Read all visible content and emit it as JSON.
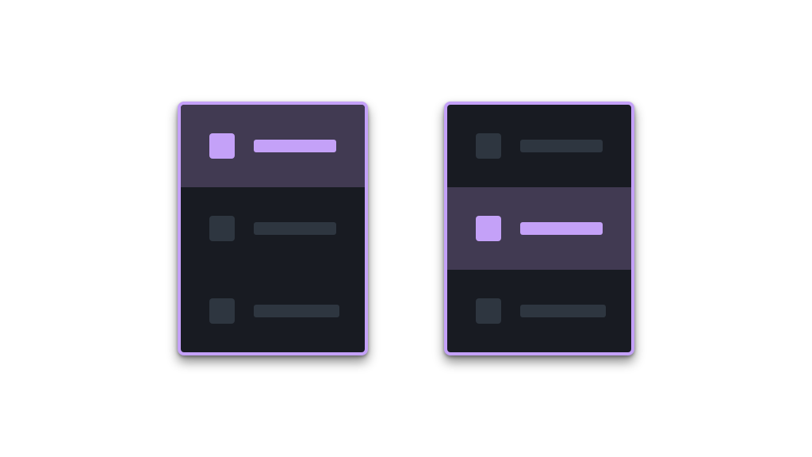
{
  "colors": {
    "accent": "#c4a1f8",
    "panel_background": "#181b22",
    "selected_row_background": "#413a52",
    "placeholder": "#2e3640",
    "page_background": "#ffffff"
  },
  "panels": [
    {
      "id": "left",
      "selected_index": 0,
      "items": [
        {
          "icon": "square-icon",
          "state": "selected"
        },
        {
          "icon": "square-icon",
          "state": "default"
        },
        {
          "icon": "square-icon",
          "state": "default"
        }
      ]
    },
    {
      "id": "right",
      "selected_index": 1,
      "items": [
        {
          "icon": "square-icon",
          "state": "default"
        },
        {
          "icon": "square-icon",
          "state": "selected"
        },
        {
          "icon": "square-icon",
          "state": "default"
        }
      ]
    }
  ]
}
